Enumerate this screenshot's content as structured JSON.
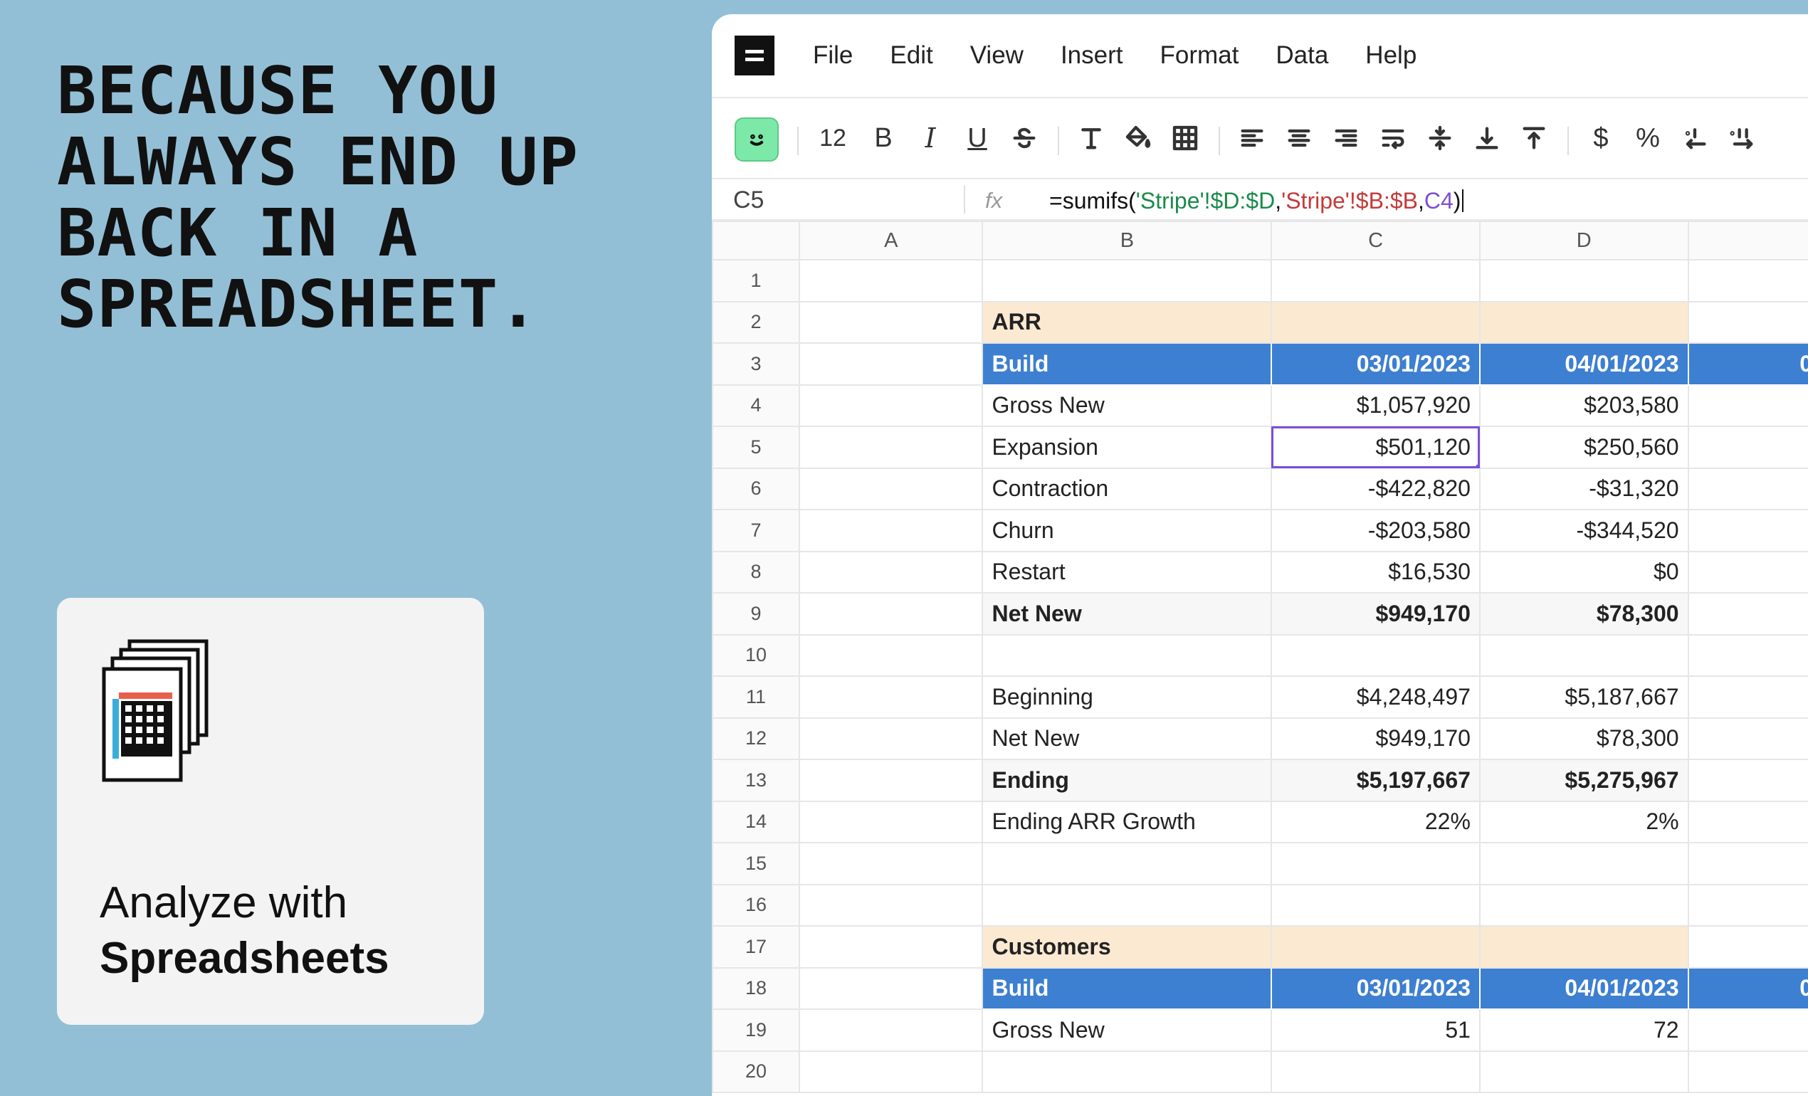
{
  "headline": [
    "BECAUSE YOU",
    "ALWAYS END UP",
    "BACK IN A",
    "SPREADSHEET."
  ],
  "promo": {
    "line1": "Analyze with",
    "line2": "Spreadsheets",
    "icon": "spreadsheet-files-icon"
  },
  "menu": [
    "File",
    "Edit",
    "View",
    "Insert",
    "Format",
    "Data",
    "Help"
  ],
  "toolbar": {
    "font_size": "12",
    "bold": "B",
    "italic": "I",
    "underline": "U",
    "currency": "$",
    "percent": "%"
  },
  "formula_bar": {
    "cell_ref": "C5",
    "fx": "fx",
    "formula_parts": [
      "=sumifs(",
      "'Stripe'!$D:$D",
      ",",
      "'Stripe'!$B:$B",
      ",",
      "C4",
      ")"
    ]
  },
  "columns": [
    "",
    "A",
    "B",
    "C",
    "D",
    ""
  ],
  "rows": [
    {
      "n": "1",
      "b": "",
      "c": "",
      "d": "",
      "style": ""
    },
    {
      "n": "2",
      "b": "ARR",
      "c": "",
      "d": "",
      "style": "section"
    },
    {
      "n": "3",
      "b": "Build",
      "c": "03/01/2023",
      "d": "04/01/2023",
      "e": "0",
      "style": "header"
    },
    {
      "n": "4",
      "b": "Gross New",
      "c": "$1,057,920",
      "d": "$203,580",
      "style": ""
    },
    {
      "n": "5",
      "b": "Expansion",
      "c": "$501,120",
      "d": "$250,560",
      "style": "",
      "selected": true
    },
    {
      "n": "6",
      "b": "Contraction",
      "c": "-$422,820",
      "d": "-$31,320",
      "style": ""
    },
    {
      "n": "7",
      "b": "Churn",
      "c": "-$203,580",
      "d": "-$344,520",
      "style": ""
    },
    {
      "n": "8",
      "b": "Restart",
      "c": "$16,530",
      "d": "$0",
      "style": ""
    },
    {
      "n": "9",
      "b": "Net New",
      "c": "$949,170",
      "d": "$78,300",
      "style": "bold"
    },
    {
      "n": "10",
      "b": "",
      "c": "",
      "d": "",
      "style": ""
    },
    {
      "n": "11",
      "b": "Beginning",
      "c": "$4,248,497",
      "d": "$5,187,667",
      "style": ""
    },
    {
      "n": "12",
      "b": "Net New",
      "c": "$949,170",
      "d": "$78,300",
      "style": ""
    },
    {
      "n": "13",
      "b": "Ending",
      "c": "$5,197,667",
      "d": "$5,275,967",
      "style": "bold"
    },
    {
      "n": "14",
      "b": "Ending ARR Growth",
      "c": "22%",
      "d": "2%",
      "style": ""
    },
    {
      "n": "15",
      "b": "",
      "c": "",
      "d": "",
      "style": ""
    },
    {
      "n": "16",
      "b": "",
      "c": "",
      "d": "",
      "style": ""
    },
    {
      "n": "17",
      "b": "Customers",
      "c": "",
      "d": "",
      "style": "section"
    },
    {
      "n": "18",
      "b": "Build",
      "c": "03/01/2023",
      "d": "04/01/2023",
      "e": "0",
      "style": "header"
    },
    {
      "n": "19",
      "b": "Gross New",
      "c": "51",
      "d": "72",
      "style": ""
    },
    {
      "n": "20",
      "b": "",
      "c": "",
      "d": "",
      "style": ""
    }
  ],
  "colors": {
    "background": "#93bfd6",
    "section": "#fbe9d2",
    "header": "#3d7fd1",
    "selection": "#7b4fd8",
    "ai_button": "#7ce9a8"
  }
}
